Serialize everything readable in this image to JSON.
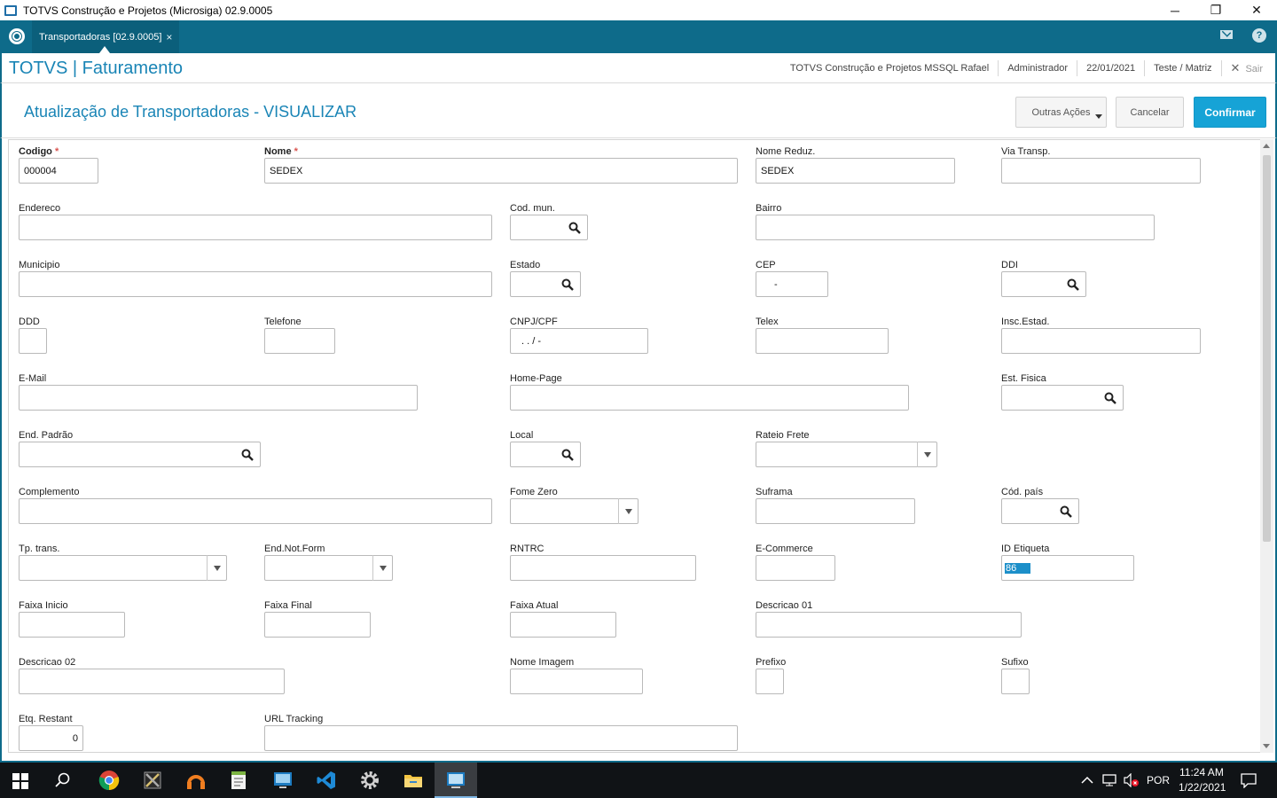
{
  "window": {
    "title": "TOTVS Construção e Projetos (Microsiga) 02.9.0005",
    "minimize": "─",
    "restore": "❐",
    "close": "✕"
  },
  "tab": {
    "label": "Transportadoras [02.9.0005]",
    "close": "×"
  },
  "header": {
    "brand": "TOTVS | Faturamento",
    "company": "TOTVS Construção e Projetos MSSQL Rafael",
    "user": "Administrador",
    "date": "22/01/2021",
    "branch": "Teste / Matriz",
    "logout_icon": "✕",
    "logout": "Sair"
  },
  "page": {
    "title": "Atualização de Transportadoras - VISUALIZAR",
    "more_actions": "Outras Ações",
    "cancel": "Cancelar",
    "confirm": "Confirmar"
  },
  "fields": {
    "codigo": {
      "label": "Codigo",
      "value": "000004"
    },
    "nome": {
      "label": "Nome",
      "value": "SEDEX"
    },
    "nome_reduz": {
      "label": "Nome Reduz.",
      "value": "SEDEX"
    },
    "via_transp": {
      "label": "Via Transp.",
      "value": ""
    },
    "endereco": {
      "label": "Endereco",
      "value": ""
    },
    "cod_mun": {
      "label": "Cod. mun.",
      "value": ""
    },
    "bairro": {
      "label": "Bairro",
      "value": ""
    },
    "municipio": {
      "label": "Municipio",
      "value": ""
    },
    "estado": {
      "label": "Estado",
      "value": ""
    },
    "cep": {
      "label": "CEP",
      "value": "-"
    },
    "ddi": {
      "label": "DDI",
      "value": ""
    },
    "ddd": {
      "label": "DDD",
      "value": ""
    },
    "telefone": {
      "label": "Telefone",
      "value": ""
    },
    "cnpj_cpf": {
      "label": "CNPJ/CPF",
      "value": ". . / -"
    },
    "telex": {
      "label": "Telex",
      "value": ""
    },
    "insc_estad": {
      "label": "Insc.Estad.",
      "value": ""
    },
    "email": {
      "label": "E-Mail",
      "value": ""
    },
    "home_page": {
      "label": "Home-Page",
      "value": ""
    },
    "est_fisica": {
      "label": "Est. Fisica",
      "value": ""
    },
    "end_padrao": {
      "label": "End. Padrão",
      "value": ""
    },
    "local": {
      "label": "Local",
      "value": ""
    },
    "rateio_frete": {
      "label": "Rateio Frete",
      "value": ""
    },
    "complemento": {
      "label": "Complemento",
      "value": ""
    },
    "fome_zero": {
      "label": "Fome Zero",
      "value": ""
    },
    "suframa": {
      "label": "Suframa",
      "value": ""
    },
    "cod_pais": {
      "label": "Cód. país",
      "value": ""
    },
    "tp_trans": {
      "label": "Tp. trans.",
      "value": ""
    },
    "end_not_form": {
      "label": "End.Not.Form",
      "value": ""
    },
    "rntrc": {
      "label": "RNTRC",
      "value": ""
    },
    "ecommerce": {
      "label": "E-Commerce",
      "value": ""
    },
    "id_etiqueta": {
      "label": "ID Etiqueta",
      "value": "86"
    },
    "faixa_inicio": {
      "label": "Faixa Inicio",
      "value": ""
    },
    "faixa_final": {
      "label": "Faixa Final",
      "value": ""
    },
    "faixa_atual": {
      "label": "Faixa Atual",
      "value": ""
    },
    "descricao_01": {
      "label": "Descricao 01",
      "value": ""
    },
    "descricao_02": {
      "label": "Descricao 02",
      "value": ""
    },
    "nome_imagem": {
      "label": "Nome Imagem",
      "value": ""
    },
    "prefixo": {
      "label": "Prefixo",
      "value": ""
    },
    "sufixo": {
      "label": "Sufixo",
      "value": ""
    },
    "etq_restant": {
      "label": "Etq. Restant",
      "value": "0"
    },
    "url_tracking": {
      "label": "URL Tracking",
      "value": ""
    }
  },
  "required_marker": "*",
  "taskbar": {
    "language": "POR",
    "time": "11:24 AM",
    "date": "1/22/2021"
  },
  "colors": {
    "accent": "#0e6b8a",
    "title_blue": "#1a85b6",
    "confirm_button": "#16a3d6",
    "required": "#d9534f"
  }
}
